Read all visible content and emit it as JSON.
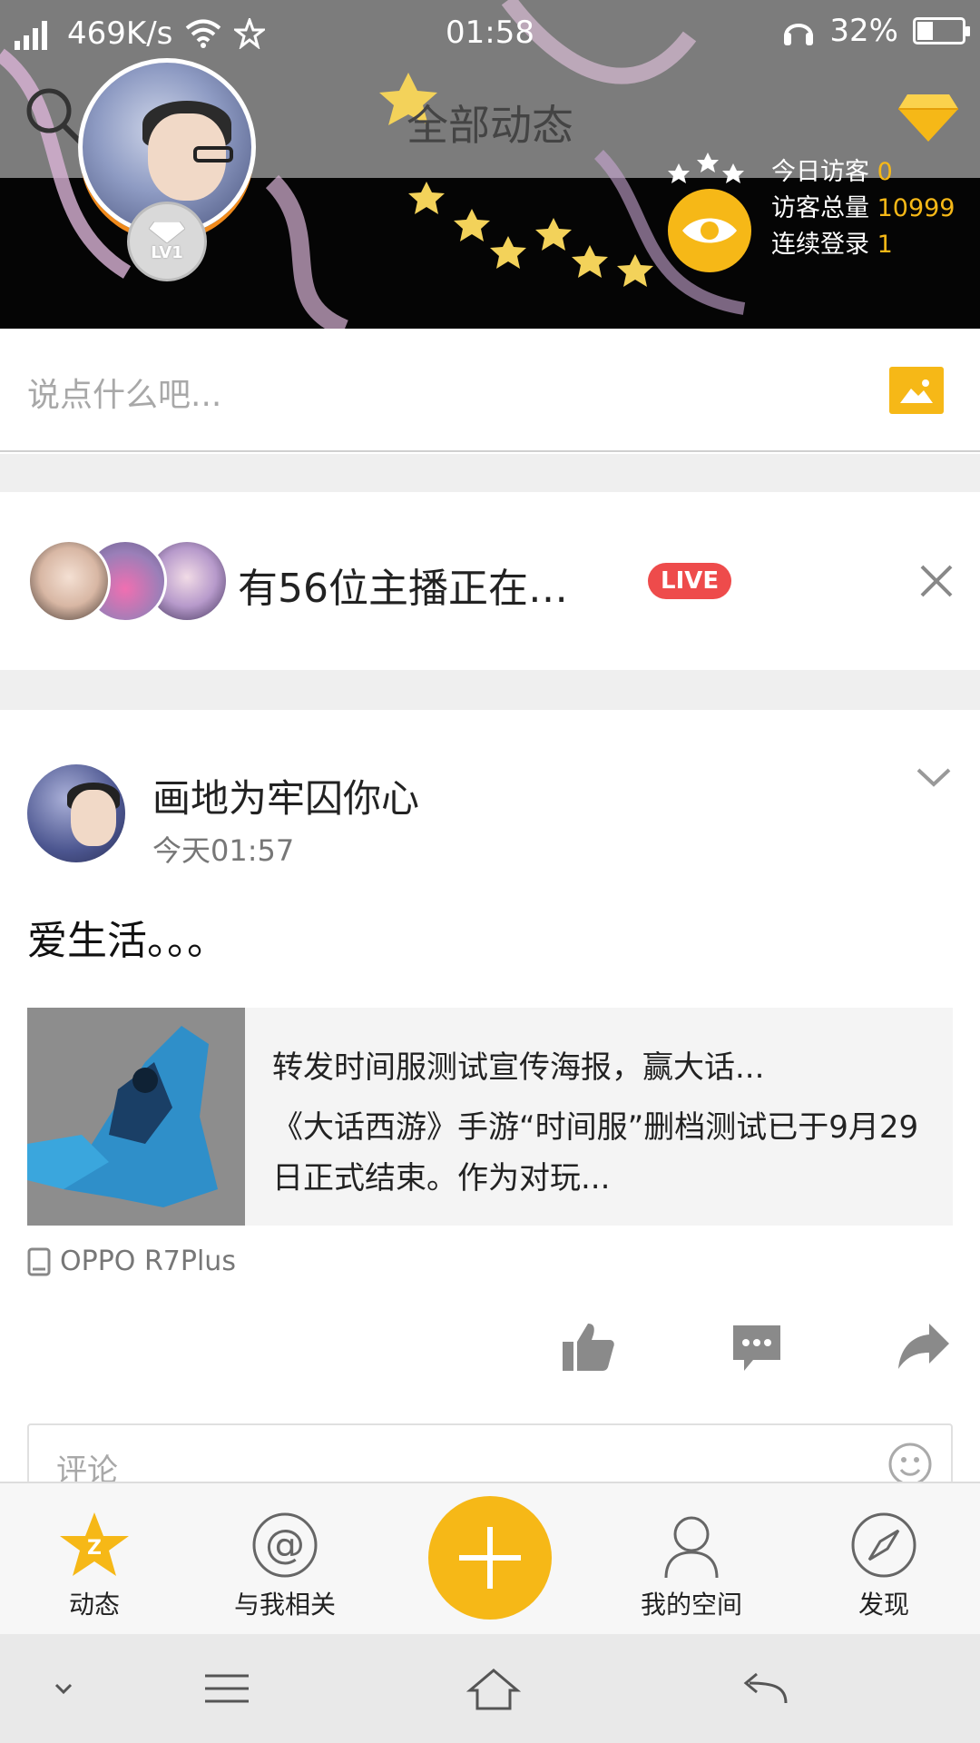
{
  "status_bar": {
    "network_speed": "469K/s",
    "time": "01:58",
    "battery_percent": "32%",
    "battery_level": 0.32
  },
  "header": {
    "title": "全部动态",
    "level": "LV1",
    "stats": [
      {
        "label": "今日访客",
        "value": "0"
      },
      {
        "label": "访客总量",
        "value": "10999"
      },
      {
        "label": "连续登录",
        "value": "1"
      }
    ]
  },
  "composer": {
    "placeholder": "说点什么吧..."
  },
  "live": {
    "text": "有56位主播正在…",
    "badge": "LIVE"
  },
  "post": {
    "author": "画地为牢囚你心",
    "time": "今天01:57",
    "content": "爱生活。。。",
    "share_title": "转发时间服测试宣传海报，赢大话...",
    "share_desc": "《大话西游》手游“时间服”删档测试已于9月29日正式结束。作为对玩...",
    "device": "OPPO R7Plus",
    "comment_placeholder": "评论"
  },
  "tabs": [
    {
      "label": "动态",
      "icon": "qzone-star-icon"
    },
    {
      "label": "与我相关",
      "icon": "at-icon"
    },
    {
      "label": "我的空间",
      "icon": "profile-icon"
    },
    {
      "label": "发现",
      "icon": "compass-icon"
    }
  ],
  "colors": {
    "accent": "#f6b817",
    "live_red": "#ee4b4b"
  }
}
